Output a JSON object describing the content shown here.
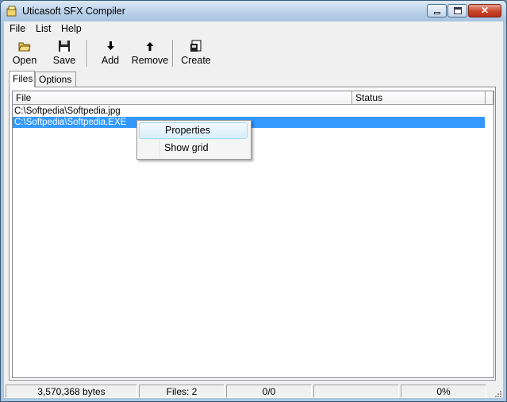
{
  "window": {
    "title": "Uticasoft SFX Compiler"
  },
  "menu": [
    "File",
    "List",
    "Help"
  ],
  "toolbar": {
    "open": "Open",
    "save": "Save",
    "add": "Add",
    "remove": "Remove",
    "create": "Create"
  },
  "tabs": {
    "files": "Files",
    "options": "Options"
  },
  "list": {
    "columns": {
      "file": "File",
      "status": "Status"
    },
    "rows": [
      {
        "file": "C:\\Softpedia\\Softpedia.jpg",
        "status": ""
      },
      {
        "file": "C:\\Softpedia\\Softpedia.EXE",
        "status": ""
      }
    ]
  },
  "context_menu": {
    "properties": "Properties",
    "show_grid": "Show grid"
  },
  "status": {
    "bytes": "3,570,368 bytes",
    "files": "Files: 2",
    "ratio": "0/0",
    "empty": "",
    "percent": "0%"
  }
}
